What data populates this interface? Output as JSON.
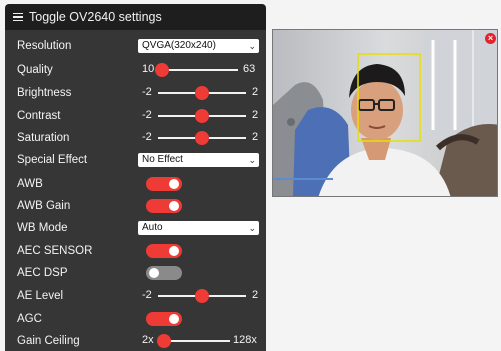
{
  "header": {
    "title": "Toggle OV2640 settings"
  },
  "controls": {
    "resolution": {
      "label": "Resolution",
      "value": "QVGA(320x240)"
    },
    "quality": {
      "label": "Quality",
      "min": "10",
      "max": "63",
      "level": 0.0
    },
    "brightness": {
      "label": "Brightness",
      "min": "-2",
      "max": "2",
      "level": 0.5
    },
    "contrast": {
      "label": "Contrast",
      "min": "-2",
      "max": "2",
      "level": 0.5
    },
    "saturation": {
      "label": "Saturation",
      "min": "-2",
      "max": "2",
      "level": 0.5
    },
    "special_effect": {
      "label": "Special Effect",
      "value": "No Effect"
    },
    "awb": {
      "label": "AWB",
      "on": true
    },
    "awb_gain": {
      "label": "AWB Gain",
      "on": true
    },
    "wb_mode": {
      "label": "WB Mode",
      "value": "Auto"
    },
    "aec_sensor": {
      "label": "AEC SENSOR",
      "on": true
    },
    "aec_dsp": {
      "label": "AEC DSP",
      "on": false
    },
    "ae_level": {
      "label": "AE Level",
      "min": "-2",
      "max": "2",
      "level": 0.5
    },
    "agc": {
      "label": "AGC",
      "on": true
    },
    "gain_ceiling": {
      "label": "Gain Ceiling",
      "min": "2x",
      "max": "128x",
      "level": 0.0
    }
  },
  "colors": {
    "accent": "#ef3b36",
    "panel": "#363636",
    "header": "#1e1e1e",
    "toggle_off": "#8a8a8a",
    "face_box": "#e8e000"
  },
  "icons": {
    "menu": "hamburger-menu-icon",
    "close": "close-icon"
  }
}
